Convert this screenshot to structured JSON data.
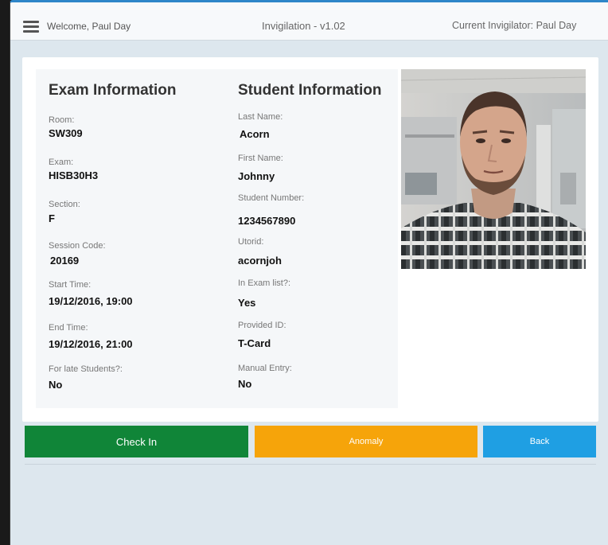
{
  "header": {
    "welcome": "Welcome, Paul Day",
    "title": "Invigilation - v1.02",
    "invigilator": "Current Invigilator: Paul Day"
  },
  "exam": {
    "title": "Exam Information",
    "fields": [
      {
        "label": "Room:",
        "value": "SW309"
      },
      {
        "label": "Exam:",
        "value": "HISB30H3"
      },
      {
        "label": "Section:",
        "value": "F"
      },
      {
        "label": "Session Code:",
        "value": "20169"
      },
      {
        "label": "Start Time:",
        "value": "19/12/2016, 19:00"
      },
      {
        "label": "End Time:",
        "value": "19/12/2016, 21:00"
      },
      {
        "label": "For late Students?:",
        "value": "No"
      }
    ]
  },
  "student": {
    "title": "Student Information",
    "fields": [
      {
        "label": "Last Name:",
        "value": "Acorn"
      },
      {
        "label": "First Name:",
        "value": "Johnny"
      },
      {
        "label": "Student Number:",
        "value": "1234567890"
      },
      {
        "label": "Utorid:",
        "value": "acornjoh"
      },
      {
        "label": "In Exam list?:",
        "value": "Yes"
      },
      {
        "label": "Provided ID:",
        "value": "T-Card"
      },
      {
        "label": "Manual Entry:",
        "value": "No"
      }
    ]
  },
  "actions": {
    "check_in": "Check In",
    "anomaly": "Anomaly",
    "back": "Back"
  },
  "colors": {
    "check_in": "#108538",
    "anomaly": "#f6a40a",
    "back": "#1f9fe3",
    "accent": "#2e86c9"
  }
}
